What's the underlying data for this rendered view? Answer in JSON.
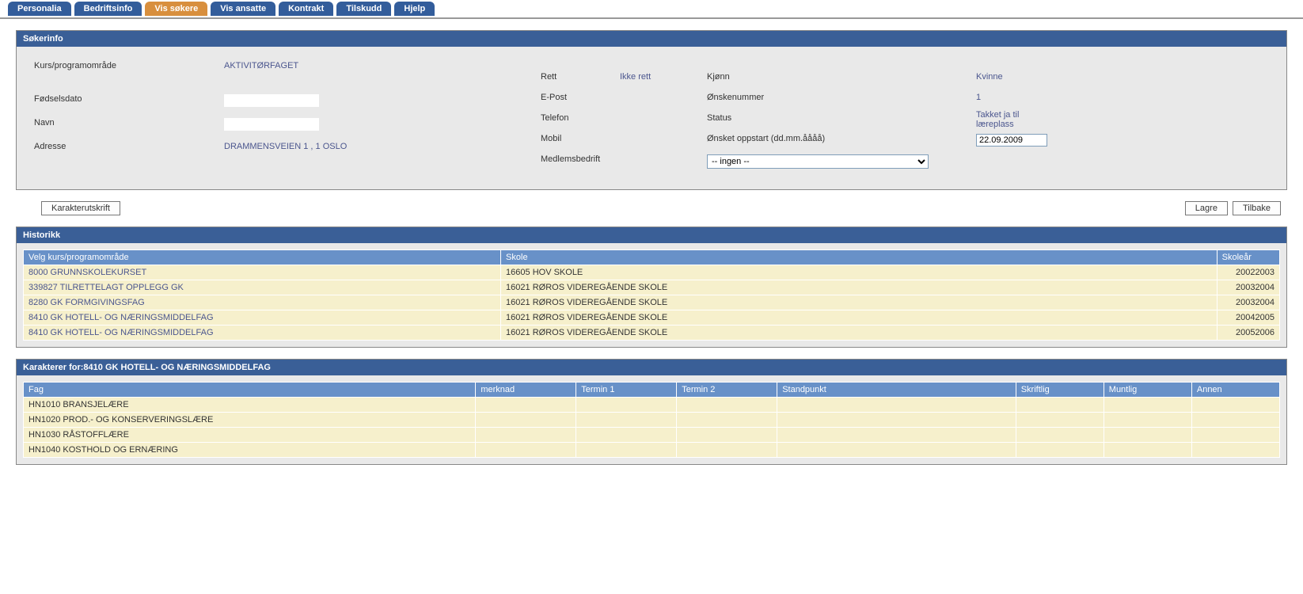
{
  "tabs": [
    {
      "label": "Personalia",
      "active": false
    },
    {
      "label": "Bedriftsinfo",
      "active": false
    },
    {
      "label": "Vis søkere",
      "active": true
    },
    {
      "label": "Vis ansatte",
      "active": false
    },
    {
      "label": "Kontrakt",
      "active": false
    },
    {
      "label": "Tilskudd",
      "active": false
    },
    {
      "label": "Hjelp",
      "active": false
    }
  ],
  "sokerinfo": {
    "header": "Søkerinfo",
    "kurs_label": "Kurs/programområde",
    "kurs_value": "AKTIVITØRFAGET",
    "fdato_label": "Fødselsdato",
    "navn_label": "Navn",
    "adresse_label": "Adresse",
    "adresse_value": "DRAMMENSVEIEN 1  , 1  OSLO",
    "rett_label": "Rett",
    "rett_value": "Ikke rett",
    "epost_label": "E-Post",
    "telefon_label": "Telefon",
    "mobil_label": "Mobil",
    "medlemsbedrift_label": "Medlemsbedrift",
    "medlemsbedrift_value": "-- ingen --",
    "kjonn_label": "Kjønn",
    "kjonn_value": "Kvinne",
    "onskenr_label": "Ønskenummer",
    "onskenr_value": "1",
    "status_label": "Status",
    "status_value": "Takket ja til læreplass",
    "oppstart_label": "Ønsket oppstart (dd.mm.åååå)",
    "oppstart_value": "22.09.2009"
  },
  "buttons": {
    "karakter": "Karakterutskrift",
    "lagre": "Lagre",
    "tilbake": "Tilbake"
  },
  "historikk": {
    "header": "Historikk",
    "col_kurs": "Velg kurs/programområde",
    "col_skole": "Skole",
    "col_aar": "Skoleår",
    "rows": [
      {
        "kode": "8000",
        "kurs": "GRUNNSKOLEKURSET",
        "skolekode": "16605",
        "skole": "HOV SKOLE",
        "aar": "20022003"
      },
      {
        "kode": "339827",
        "kurs": "TILRETTELAGT OPPLEGG GK",
        "skolekode": "16021",
        "skole": "RØROS VIDEREGÅENDE SKOLE",
        "aar": "20032004"
      },
      {
        "kode": "8280",
        "kurs": "GK FORMGIVINGSFAG",
        "skolekode": "16021",
        "skole": "RØROS VIDEREGÅENDE SKOLE",
        "aar": "20032004"
      },
      {
        "kode": "8410",
        "kurs": "GK HOTELL- OG NÆRINGSMIDDELFAG",
        "skolekode": "16021",
        "skole": "RØROS VIDEREGÅENDE SKOLE",
        "aar": "20042005"
      },
      {
        "kode": "8410",
        "kurs": "GK HOTELL- OG NÆRINGSMIDDELFAG",
        "skolekode": "16021",
        "skole": "RØROS VIDEREGÅENDE SKOLE",
        "aar": "20052006"
      }
    ]
  },
  "karakterer": {
    "header": "Karakterer for:8410  GK HOTELL- OG NÆRINGSMIDDELFAG",
    "col_fag": "Fag",
    "col_merknad": "merknad",
    "col_t1": "Termin 1",
    "col_t2": "Termin 2",
    "col_stand": "Standpunkt",
    "col_skrift": "Skriftlig",
    "col_munt": "Muntlig",
    "col_annen": "Annen",
    "rows": [
      {
        "kode": "HN1010",
        "fag": "BRANSJELÆRE"
      },
      {
        "kode": "HN1020",
        "fag": "PROD.- OG KONSERVERINGSLÆRE"
      },
      {
        "kode": "HN1030",
        "fag": "RÅSTOFFLÆRE"
      },
      {
        "kode": "HN1040",
        "fag": "KOSTHOLD OG ERNÆRING"
      }
    ]
  }
}
